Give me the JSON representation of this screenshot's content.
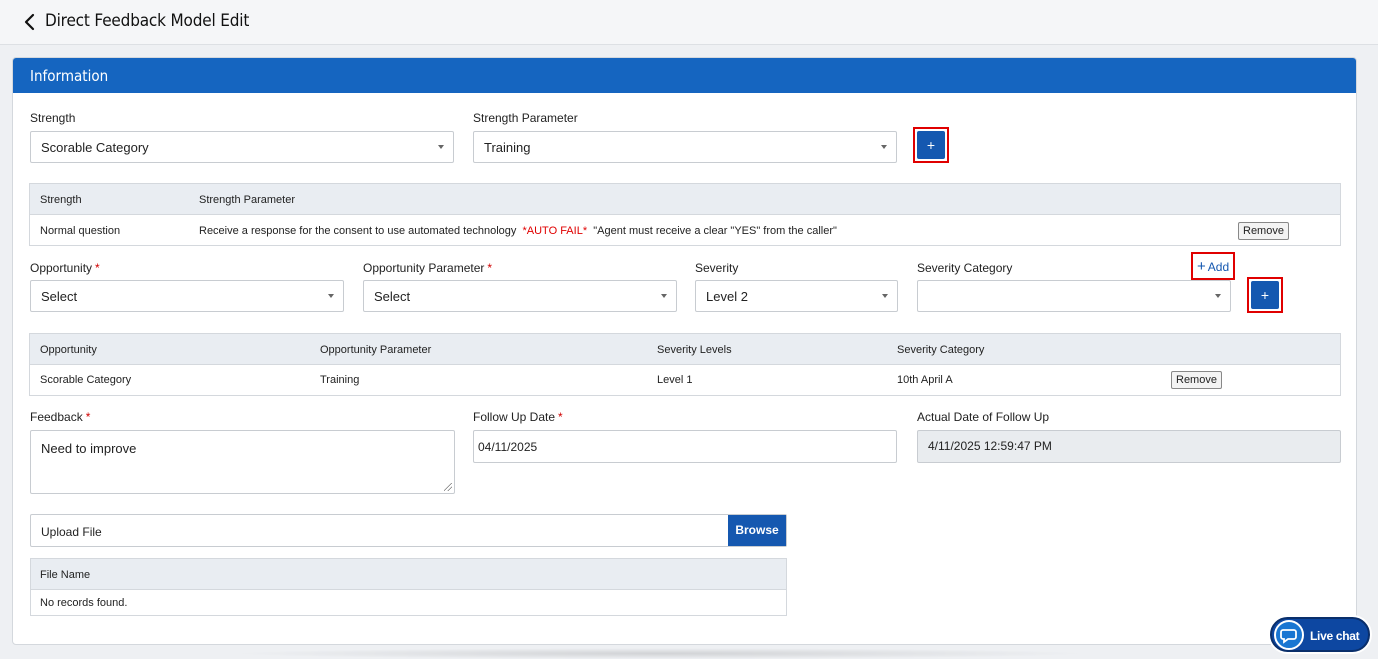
{
  "header": {
    "title": "Direct Feedback Model Edit"
  },
  "card": {
    "title": "Information"
  },
  "strength": {
    "label": "Strength",
    "value": "Scorable Category",
    "param_label": "Strength Parameter",
    "param_value": "Training",
    "add_symbol": "+"
  },
  "strength_table": {
    "columns": [
      "Strength",
      "Strength Parameter"
    ],
    "rows": [
      {
        "strength": "Normal question",
        "param_text": "Receive a response for the consent to use automated technology",
        "param_flag": "*AUTO FAIL*",
        "param_note": "\"Agent must receive a clear \"YES\" from the caller\"",
        "remove_label": "Remove"
      }
    ]
  },
  "opportunity": {
    "label": "Opportunity",
    "value": "Select",
    "param_label": "Opportunity Parameter",
    "param_value": "Select",
    "severity_label": "Severity",
    "severity_value": "Level 2",
    "category_label": "Severity Category",
    "category_value": "",
    "add_link_label": "Add",
    "add_link_plus": "+",
    "add_symbol": "+",
    "required_mark": "*"
  },
  "opportunity_table": {
    "columns": [
      "Opportunity",
      "Opportunity Parameter",
      "Severity Levels",
      "Severity Category"
    ],
    "rows": [
      {
        "opportunity": "Scorable Category",
        "parameter": "Training",
        "severity": "Level 1",
        "category": "10th April A",
        "remove_label": "Remove"
      }
    ]
  },
  "feedback": {
    "label": "Feedback",
    "value": "Need to improve"
  },
  "follow_up": {
    "label": "Follow Up Date",
    "value": "04/11/2025"
  },
  "actual_follow_up": {
    "label": "Actual Date of Follow Up",
    "value": "4/11/2025 12:59:47 PM"
  },
  "upload": {
    "placeholder": "Upload File",
    "browse_label": "Browse"
  },
  "file_table": {
    "column": "File Name",
    "empty_text": "No records found."
  },
  "live_chat": {
    "label": "Live chat"
  }
}
